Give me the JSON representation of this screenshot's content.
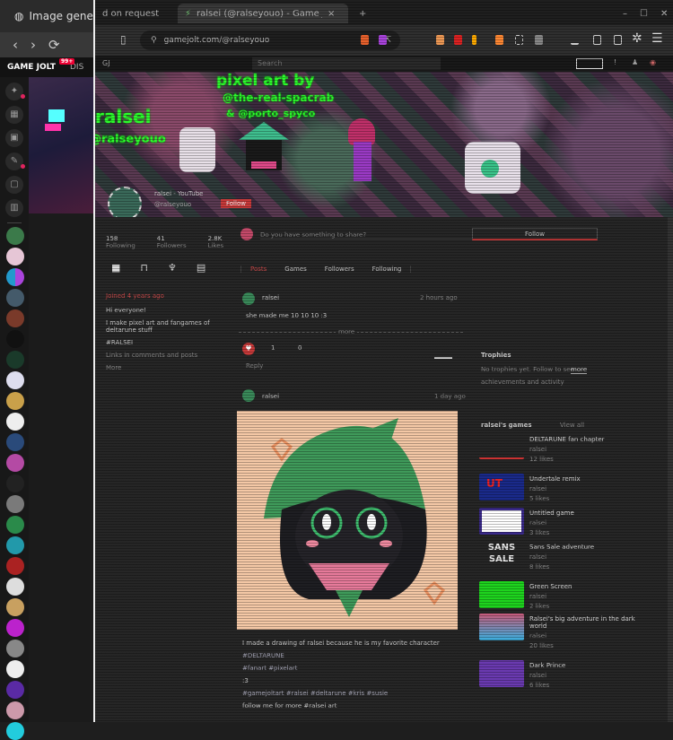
{
  "background_window": {
    "tab_title": "Image gene",
    "nav": {
      "back": "‹",
      "forward": "›",
      "reload": "⟳"
    },
    "site": {
      "logo": "GAME JOLT",
      "notif_badge": "99+",
      "nav_link": "DIS"
    }
  },
  "foreground_window": {
    "tabs": [
      {
        "title": "d on request"
      },
      {
        "title": "ralsei (@ralseyouo) - Game Jolt",
        "close": "×"
      }
    ],
    "new_tab": "+",
    "window_controls": {
      "minimize": "–",
      "maximize": "☐",
      "close": "✕"
    },
    "url": "gamejolt.com/@ralseyouo",
    "site_header": {
      "left": "GJ",
      "search_placeholder": "Search"
    },
    "banner": {
      "line1": "pixel art by",
      "line2": "@the-real-spacrab",
      "line3": "& @porto_spyco",
      "name_overlay": "ralsei",
      "handle_overlay": "@ralseyouo"
    },
    "profile": {
      "display_name": "ralsei - YouTube",
      "username": "@ralseyouo",
      "follow_button": "Follow"
    },
    "stats": [
      {
        "value": "158",
        "label": "Following"
      },
      {
        "value": "41",
        "label": "Followers"
      },
      {
        "value": "2.8K",
        "label": "Likes"
      }
    ],
    "sidebar_icons": [
      "games-icon",
      "shop-icon",
      "trophy-icon",
      "library-icon"
    ],
    "about": {
      "heading": "Joined 4 years ago",
      "lines": [
        "Hi everyone!",
        "I make pixel art and fangames of",
        "deltarune stuff",
        "#RALSEI"
      ],
      "footer": "Links in comments and posts",
      "more": "More"
    },
    "feed": {
      "compose_placeholder": "Do you have something to share?",
      "tabs": [
        "Posts",
        "Games",
        "Followers",
        "Following"
      ],
      "post1": {
        "author": "ralsei",
        "meta": "2 hours ago",
        "text": "she made me 10 10 10 :3",
        "divider": "more"
      },
      "reactions": {
        "like_count": "1",
        "comment_count": "0",
        "reply": "Reply"
      },
      "post2": {
        "author": "ralsei",
        "meta": "1 day ago"
      },
      "caption_lines": [
        "I made a drawing of ralsei because he is my favorite character",
        "#DELTARUNE",
        "#fanart #pixelart",
        ":3",
        "#gamejoltart #ralsei #deltarune #kris #susie",
        "follow me for more #ralsei art"
      ]
    },
    "right": {
      "follow_label": "Follow",
      "trophies_heading": "Trophies",
      "trophies_text": "No trophies yet. Follow to see",
      "trophies_link": "more",
      "trophies_sub": "achievements and activity",
      "games_heading": "ralsei's games",
      "games_link": "View all",
      "games": [
        {
          "title": "DELTARUNE fan chapter",
          "sub": "ralsei",
          "meta": "12 likes"
        },
        {
          "title": "Undertale remix",
          "sub": "ralsei",
          "meta": "5 likes"
        },
        {
          "title": "Untitled game",
          "sub": "ralsei",
          "meta": "3 likes"
        },
        {
          "title": "Sans Sale adventure",
          "sub": "ralsei",
          "meta": "8 likes"
        },
        {
          "title": "Green Screen",
          "sub": "ralsei",
          "meta": "2 likes"
        },
        {
          "title": "Ralsei's big adventure in the dark world",
          "sub": "ralsei",
          "meta": "20 likes"
        },
        {
          "title": "Dark Prince",
          "sub": "ralsei",
          "meta": "6 likes"
        }
      ]
    }
  },
  "colors": {
    "accent": "#d03a3a",
    "banner_text": "#2dfc2d",
    "bg": "#262626"
  }
}
